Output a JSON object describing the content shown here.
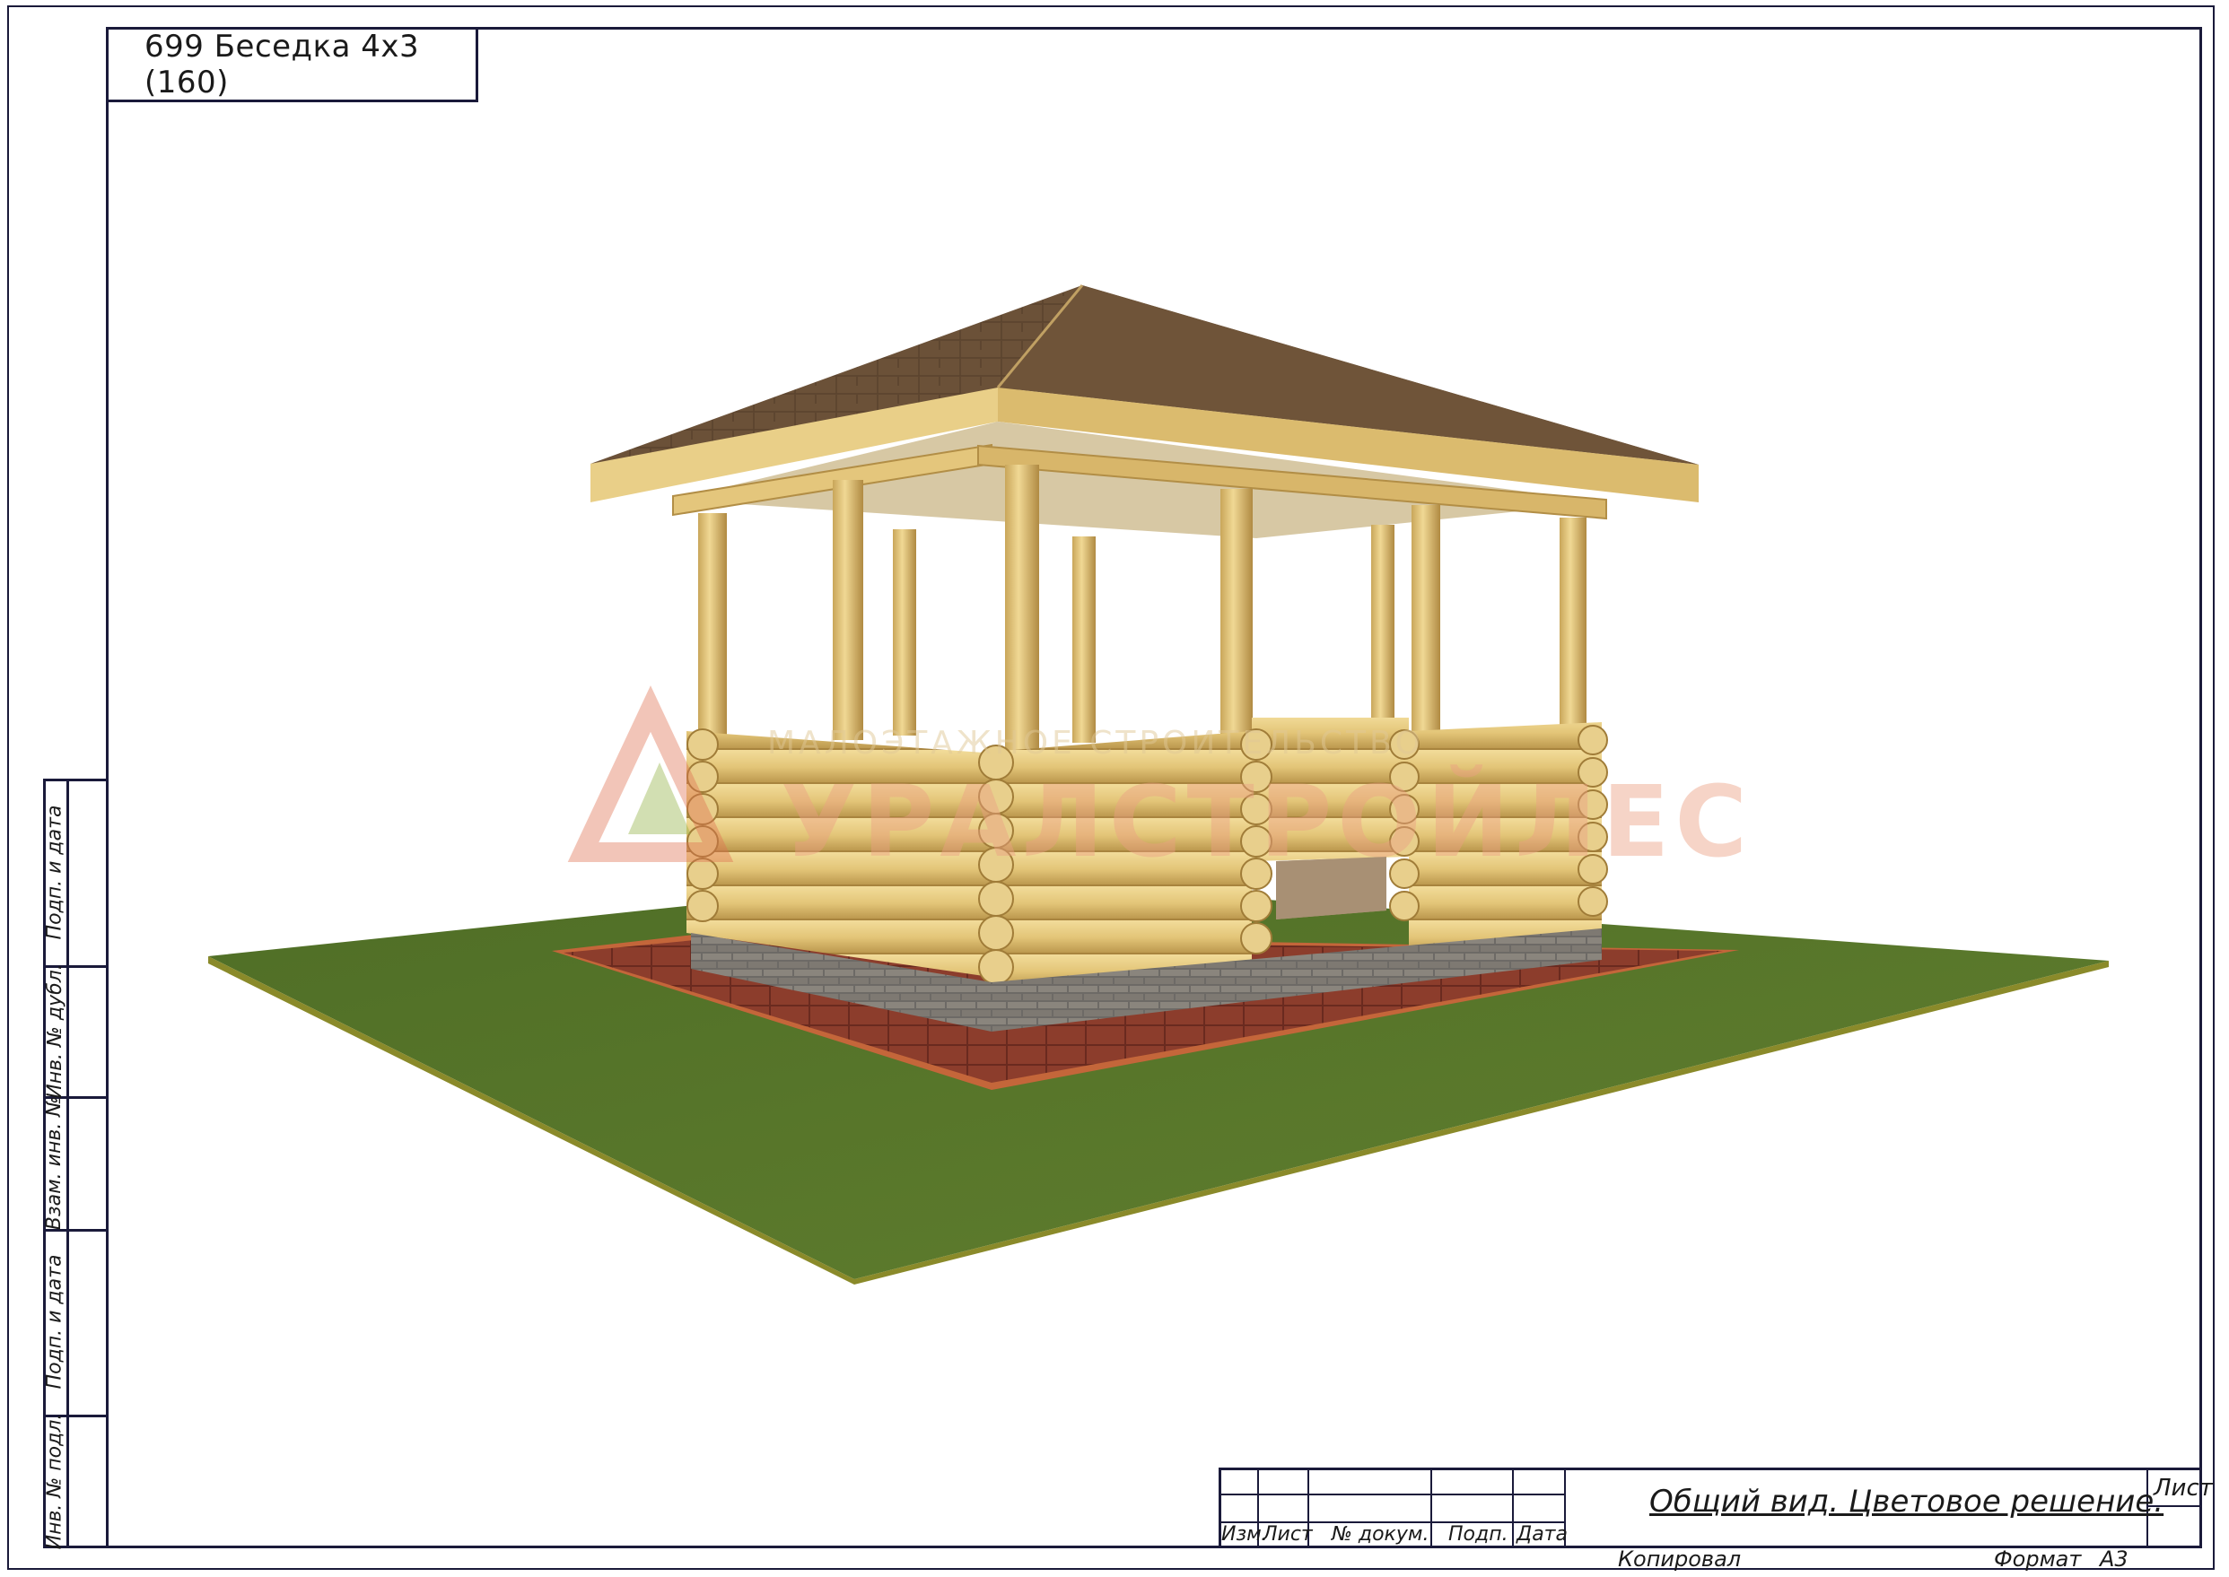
{
  "document": {
    "title": "699 Беседка 4х3 (160)",
    "sheet_title": "Общий вид. Цветовое решение.",
    "watermark": {
      "subtitle": "МАЛОЭТАЖНОЕ СТРОИТЕЛЬСТВО",
      "brand": "УРАЛСТРОЙЛЕС"
    }
  },
  "side_stamp": {
    "labels": [
      "Подп. и дата",
      "Инв. № дубл.",
      "Взам. инв. №",
      "Подп. и дата",
      "Инв. № подл."
    ]
  },
  "title_block": {
    "columns": [
      "Изм.",
      "Лист",
      "№ докум.",
      "Подп.",
      "Дата"
    ],
    "sheet_label": "Лист",
    "footer": {
      "copied": "Копировал",
      "format_label": "Формат",
      "format_value": "А3"
    }
  },
  "colors": {
    "frame": "#1a1a3a",
    "grass": "#55762a",
    "paving": "#8c3d2c",
    "roof": "#6b5138",
    "logs": "#e5c77f"
  }
}
